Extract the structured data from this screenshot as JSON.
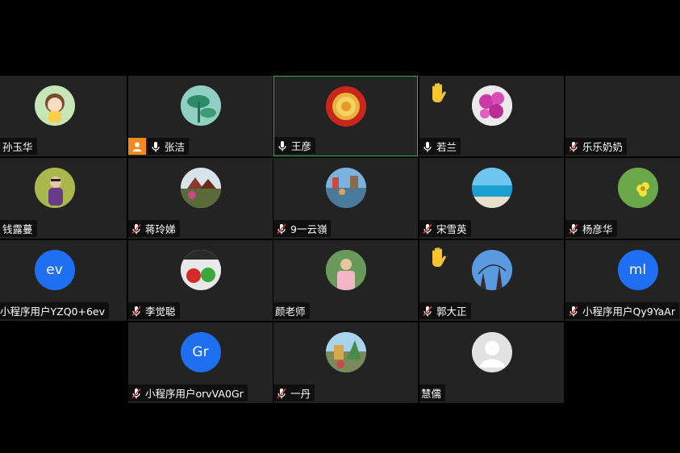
{
  "colors": {
    "background": "#000000",
    "tile": "#232323",
    "active_border": "#2fae55",
    "initials_avatar": "#1e6ff2",
    "host_badge": "#f28a1e",
    "raised_hand": "#f4c433"
  },
  "participants": [
    {
      "name": "孙玉华",
      "mic": "none"
    },
    {
      "name": "张洁",
      "mic": "on",
      "host": true
    },
    {
      "name": "王彦",
      "mic": "on",
      "active_speaker": true
    },
    {
      "name": "若兰",
      "mic": "on",
      "hand_raised": true
    },
    {
      "name": "乐乐奶奶",
      "mic": "muted"
    },
    {
      "name": "钱露蔓",
      "mic": "none"
    },
    {
      "name": "蒋玲娣",
      "mic": "muted"
    },
    {
      "name": "9一云嶺",
      "mic": "muted"
    },
    {
      "name": "宋雪英",
      "mic": "muted"
    },
    {
      "name": "杨彦华",
      "mic": "muted"
    },
    {
      "name": "小程序用户YZQ0+6ev",
      "mic": "none",
      "initials": "ev"
    },
    {
      "name": "李觉聪",
      "mic": "muted"
    },
    {
      "name": "颜老师",
      "mic": "none"
    },
    {
      "name": "郭大正",
      "mic": "muted",
      "hand_raised": true
    },
    {
      "name": "小程序用户Qy9YaAr",
      "mic": "muted",
      "initials": "ml"
    },
    {
      "name": "小程序用户orvVA0Gr",
      "mic": "muted",
      "initials": "Gr"
    },
    {
      "name": "一丹",
      "mic": "muted"
    },
    {
      "name": "慧儒",
      "mic": "none",
      "default_avatar": true
    }
  ]
}
